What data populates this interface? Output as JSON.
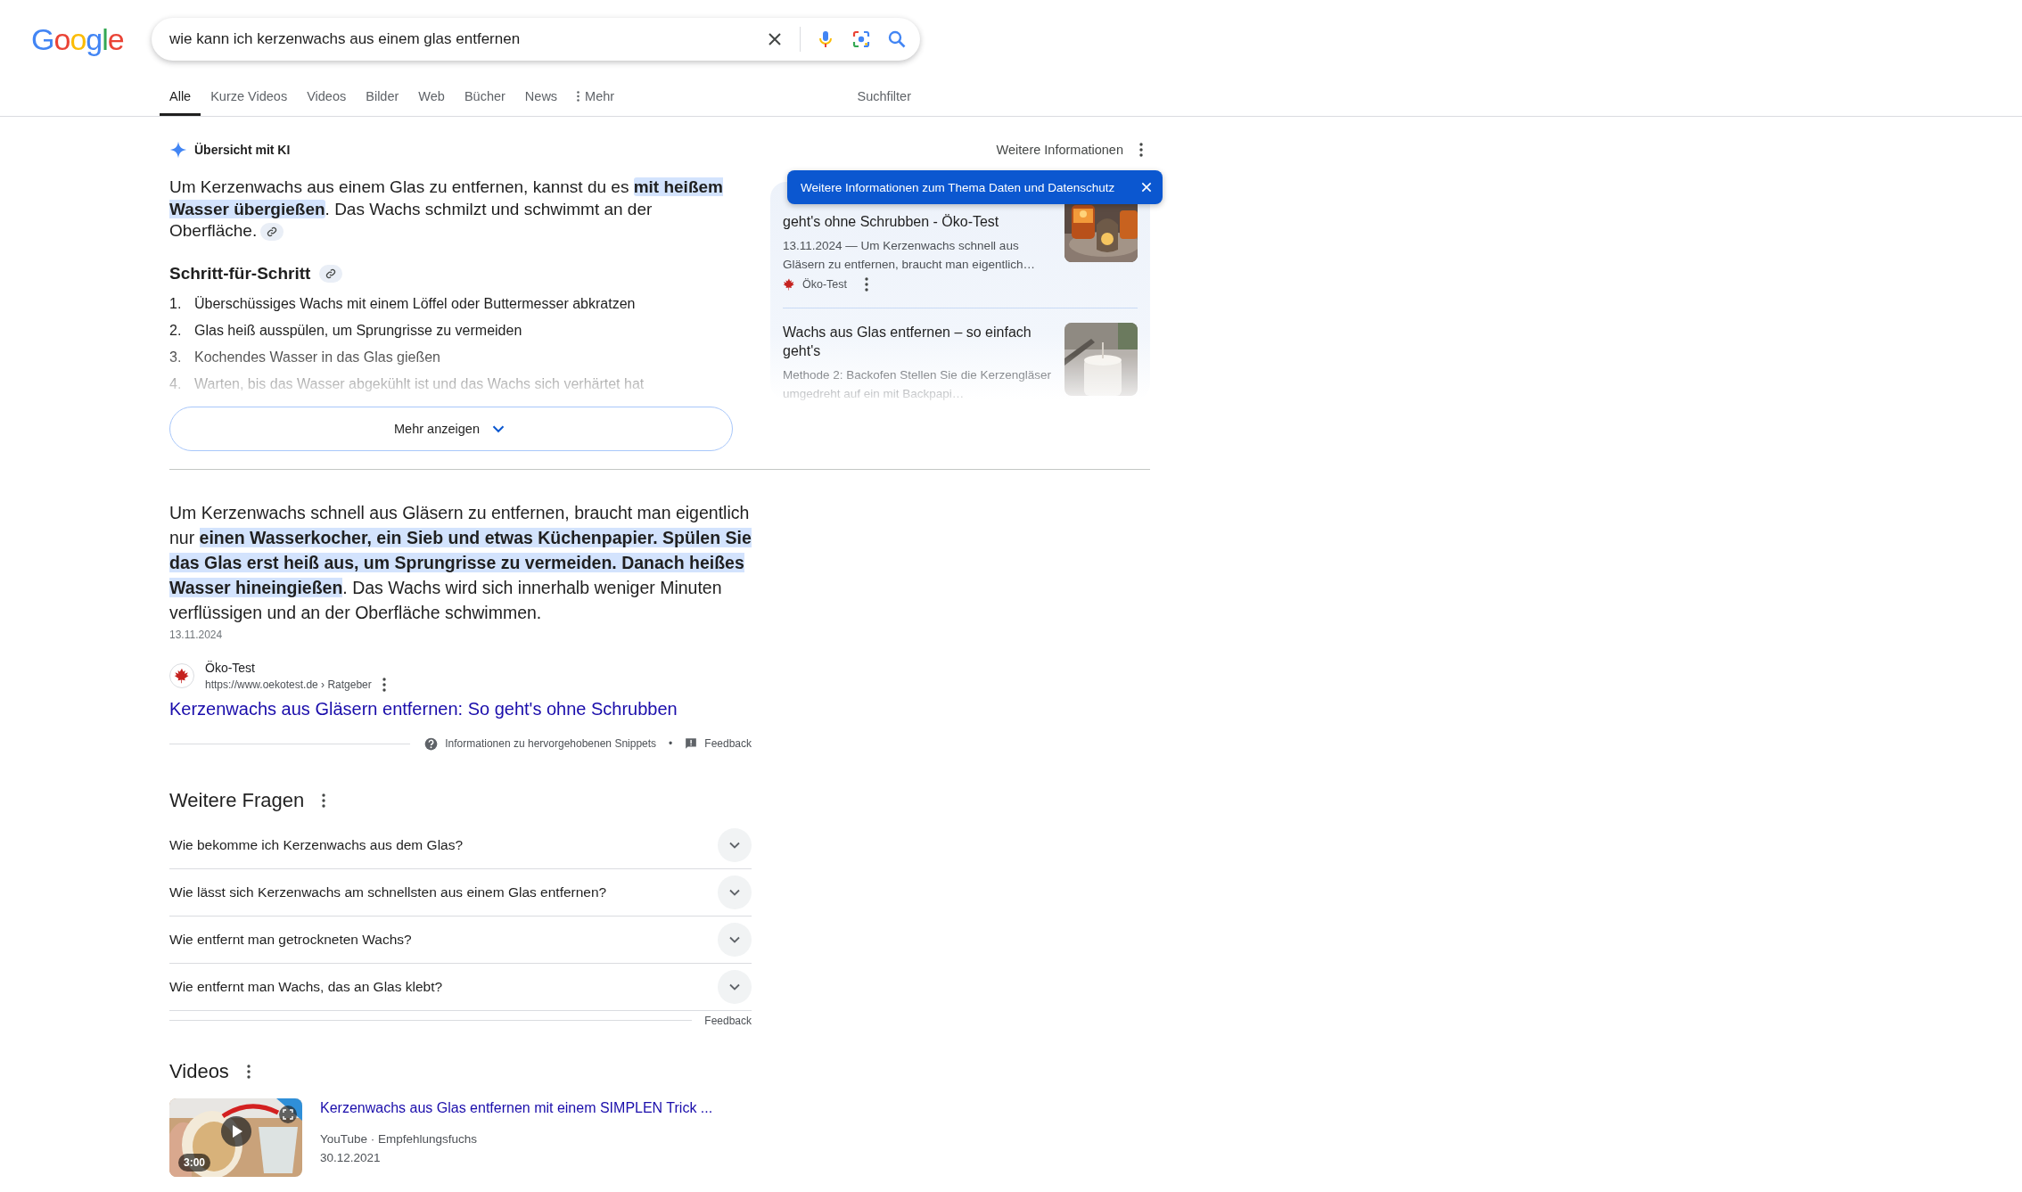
{
  "logo": "Google",
  "search": {
    "value": "wie kann ich kerzenwachs aus einem glas entfernen"
  },
  "tabs": [
    {
      "label": "Alle",
      "selected": true,
      "kind": "tab"
    },
    {
      "label": "Kurze Videos",
      "selected": false,
      "kind": "tab"
    },
    {
      "label": "Videos",
      "selected": false,
      "kind": "tab"
    },
    {
      "label": "Bilder",
      "selected": false,
      "kind": "tab"
    },
    {
      "label": "Web",
      "selected": false,
      "kind": "tab"
    },
    {
      "label": "Bücher",
      "selected": false,
      "kind": "tab"
    },
    {
      "label": "News",
      "selected": false,
      "kind": "tab"
    },
    {
      "label": "Mehr",
      "selected": false,
      "kind": "menu"
    }
  ],
  "search_tools": "Suchfilter",
  "ai_overview": {
    "title": "Übersicht mit KI",
    "more_info": "Weitere Informationen",
    "tooltip": "Weitere Informationen zum Thema Daten und Datenschutz",
    "summary": "Um Kerzenwachs aus einem Glas zu entfernen, kannst du es **mit heißem Wasser übergießen**. Das Wachs schmilzt und schwimmt an der Oberfläche.",
    "steps_title": "Schritt-für-Schritt",
    "steps": [
      {
        "number": "1.",
        "text": "Überschüssiges Wachs mit einem Löffel oder Buttermesser abkratzen"
      },
      {
        "number": "2.",
        "text": "Glas heiß ausspülen, um Sprungrisse zu vermeiden"
      },
      {
        "number": "3.",
        "text": "Kochendes Wasser in das Glas gießen"
      },
      {
        "number": "4.",
        "text": "Warten, bis das Wasser abgekühlt ist und das Wachs sich verhärtet hat"
      }
    ],
    "show_more": "Mehr anzeigen",
    "sources": [
      {
        "title": "geht's ohne Schrubben - Öko-Test",
        "snippet": "13.11.2024 — Um Kerzenwachs schnell aus Gläsern zu entfernen, braucht man eigentlich…",
        "site": "Öko-Test"
      },
      {
        "title": "Wachs aus Glas entfernen – so einfach geht's",
        "snippet": "Methode 2: Backofen Stellen Sie die Kerzengläser umgedreht auf ein mit Backpapi…"
      }
    ]
  },
  "featured_snippet": {
    "text": "Um Kerzenwachs schnell aus Gläsern zu entfernen, braucht man eigentlich nur **einen Wasserkocher, ein Sieb und etwas Küchenpapier. Spülen Sie das Glas erst heiß aus, um Sprungrisse zu vermeiden. Danach heißes Wasser hineingießen**. Das Wachs wird sich innerhalb weniger Minuten verflüssigen und an der Oberfläche schwimmen.",
    "date": "13.11.2024",
    "site": "Öko-Test",
    "url": "https://www.oekotest.de › Ratgeber",
    "link": "Kerzenwachs aus Gläsern entfernen: So geht's ohne Schrubben",
    "about": "Informationen zu hervorgehobenen Snippets",
    "separator": "•",
    "feedback": "Feedback"
  },
  "related_questions": {
    "title": "Weitere Fragen",
    "items": [
      {
        "question": "Wie bekomme ich Kerzenwachs aus dem Glas?",
        "expanded": false
      },
      {
        "question": "Wie lässt sich Kerzenwachs am schnellsten aus einem Glas entfernen?",
        "expanded": false
      },
      {
        "question": "Wie entfernt man getrockneten Wachs?",
        "expanded": false
      },
      {
        "question": "Wie entfernt man Wachs, das an Glas klebt?",
        "expanded": false
      }
    ],
    "feedback": "Feedback"
  },
  "videos": {
    "title": "Videos",
    "items": [
      {
        "title": "Kerzenwachs aus Glas entfernen mit einem SIMPLEN Trick ...",
        "source": "YouTube · Empfehlungsfuchs",
        "date": "30.12.2021",
        "duration": "3:00"
      }
    ]
  }
}
